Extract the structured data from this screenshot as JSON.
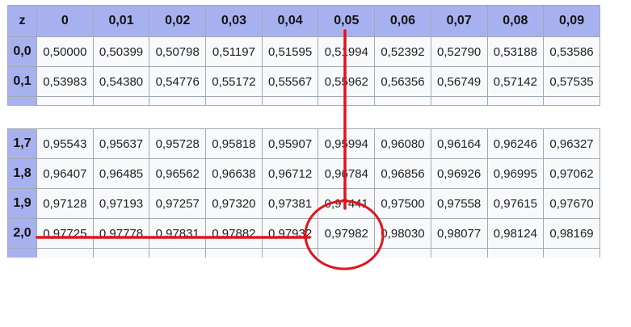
{
  "header": {
    "z_label": "z",
    "columns": [
      "0",
      "0,01",
      "0,02",
      "0,03",
      "0,04",
      "0,05",
      "0,06",
      "0,07",
      "0,08",
      "0,09"
    ]
  },
  "rows_top": [
    {
      "z": "0,0",
      "values": [
        "0,50000",
        "0,50399",
        "0,50798",
        "0,51197",
        "0,51595",
        "0,51994",
        "0,52392",
        "0,52790",
        "0,53188",
        "0,53586"
      ]
    },
    {
      "z": "0,1",
      "values": [
        "0,53983",
        "0,54380",
        "0,54776",
        "0,55172",
        "0,55567",
        "0,55962",
        "0,56356",
        "0,56749",
        "0,57142",
        "0,57535"
      ]
    }
  ],
  "rows_bottom": [
    {
      "z": "1,7",
      "values": [
        "0,95543",
        "0,95637",
        "0,95728",
        "0,95818",
        "0,95907",
        "0,95994",
        "0,96080",
        "0,96164",
        "0,96246",
        "0,96327"
      ]
    },
    {
      "z": "1,8",
      "values": [
        "0,96407",
        "0,96485",
        "0,96562",
        "0,96638",
        "0,96712",
        "0,96784",
        "0,96856",
        "0,96926",
        "0,96995",
        "0,97062"
      ]
    },
    {
      "z": "1,9",
      "values": [
        "0,97128",
        "0,97193",
        "0,97257",
        "0,97320",
        "0,97381",
        "0,97441",
        "0,97500",
        "0,97558",
        "0,97615",
        "0,97670"
      ]
    },
    {
      "z": "2,0",
      "values": [
        "0,97725",
        "0,97778",
        "0,97831",
        "0,97882",
        "0,97932",
        "0,97982",
        "0,98030",
        "0,98077",
        "0,98124",
        "0,98169"
      ]
    }
  ],
  "annotation": {
    "color": "#e0141e",
    "highlight_row_z": "2,0",
    "highlight_column": "0,05",
    "highlight_value": "0,97982"
  }
}
